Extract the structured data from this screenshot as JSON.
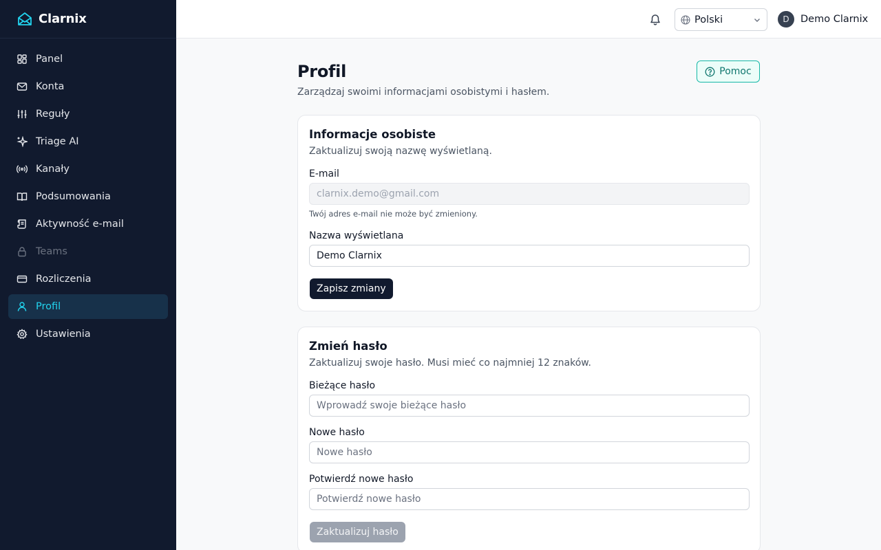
{
  "app": {
    "name": "Clarnix"
  },
  "sidebar": {
    "items": [
      {
        "label": "Panel",
        "icon": "dashboard-icon",
        "state": "normal"
      },
      {
        "label": "Konta",
        "icon": "mail-icon",
        "state": "normal"
      },
      {
        "label": "Reguły",
        "icon": "sliders-icon",
        "state": "normal"
      },
      {
        "label": "Triage AI",
        "icon": "sparkles-icon",
        "state": "normal"
      },
      {
        "label": "Kanały",
        "icon": "broadcast-icon",
        "state": "normal"
      },
      {
        "label": "Podsumowania",
        "icon": "book-icon",
        "state": "normal"
      },
      {
        "label": "Aktywność e-mail",
        "icon": "scroll-icon",
        "state": "normal"
      },
      {
        "label": "Teams",
        "icon": "lock-icon",
        "state": "disabled"
      },
      {
        "label": "Rozliczenia",
        "icon": "credit-card-icon",
        "state": "normal"
      },
      {
        "label": "Profil",
        "icon": "user-icon",
        "state": "active"
      },
      {
        "label": "Ustawienia",
        "icon": "gear-icon",
        "state": "normal"
      }
    ]
  },
  "topbar": {
    "language": "Polski",
    "user_initial": "D",
    "user_name": "Demo Clarnix"
  },
  "page": {
    "title": "Profil",
    "subtitle": "Zarządzaj swoimi informacjami osobistymi i hasłem.",
    "help_label": "Pomoc"
  },
  "personal": {
    "title": "Informacje osobiste",
    "description": "Zaktualizuj swoją nazwę wyświetlaną.",
    "email_label": "E-mail",
    "email_value": "clarnix.demo@gmail.com",
    "email_hint": "Twój adres e-mail nie może być zmieniony.",
    "name_label": "Nazwa wyświetlana",
    "name_value": "Demo Clarnix",
    "save_label": "Zapisz zmiany"
  },
  "password": {
    "title": "Zmień hasło",
    "description": "Zaktualizuj swoje hasło. Musi mieć co najmniej 12 znaków.",
    "current_label": "Bieżące hasło",
    "current_placeholder": "Wprowadź swoje bieżące hasło",
    "new_label": "Nowe hasło",
    "new_placeholder": "Nowe hasło",
    "confirm_label": "Potwierdź nowe hasło",
    "confirm_placeholder": "Potwierdź nowe hasło",
    "update_label": "Zaktualizuj hasło"
  },
  "colors": {
    "sidebar_bg": "#111a2e",
    "accent": "#22d3ee",
    "help_accent": "#14b8a6"
  }
}
